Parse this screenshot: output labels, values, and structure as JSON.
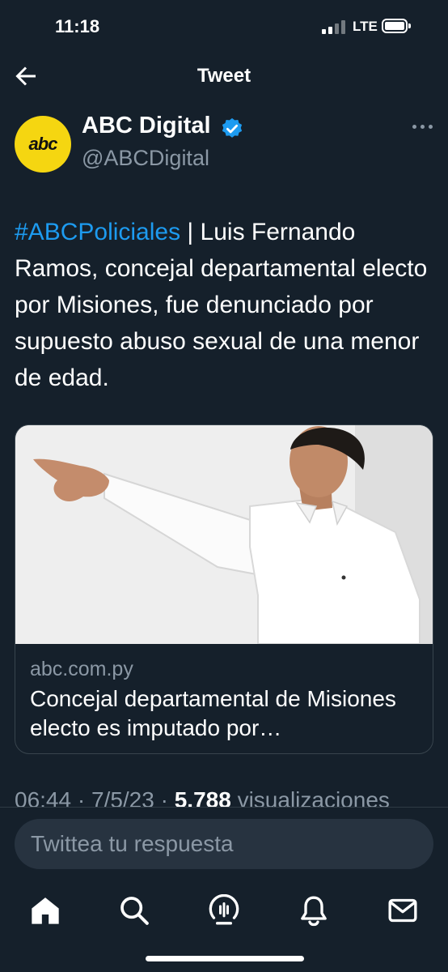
{
  "status": {
    "time": "11:18",
    "network": "LTE"
  },
  "header": {
    "title": "Tweet"
  },
  "author": {
    "name": "ABC Digital",
    "handle": "@ABCDigital",
    "avatar_text": "abc",
    "avatar_color": "#f5d611",
    "verified_color": "#1d9bf0"
  },
  "tweet": {
    "hashtag": "#ABCPoliciales",
    "text": " | Luis Fernando Ramos, concejal departamental electo por Misiones, fue denunciado por supuesto abuso sexual de una menor de edad."
  },
  "card": {
    "domain": "abc.com.py",
    "title": "Concejal departamental de Misiones electo es imputado por…"
  },
  "meta": {
    "time": "06:44",
    "sep1": " · ",
    "date": "7/5/23",
    "sep2": " · ",
    "views": "5.788",
    "views_label": " visualizaciones"
  },
  "reply": {
    "placeholder": "Twittea tu respuesta"
  },
  "tabs": [
    "home-icon",
    "search-icon",
    "spaces-icon",
    "notifications-icon",
    "messages-icon"
  ],
  "colors": {
    "background": "#15202b",
    "accent": "#1d9bf0",
    "muted": "#8b98a5"
  }
}
